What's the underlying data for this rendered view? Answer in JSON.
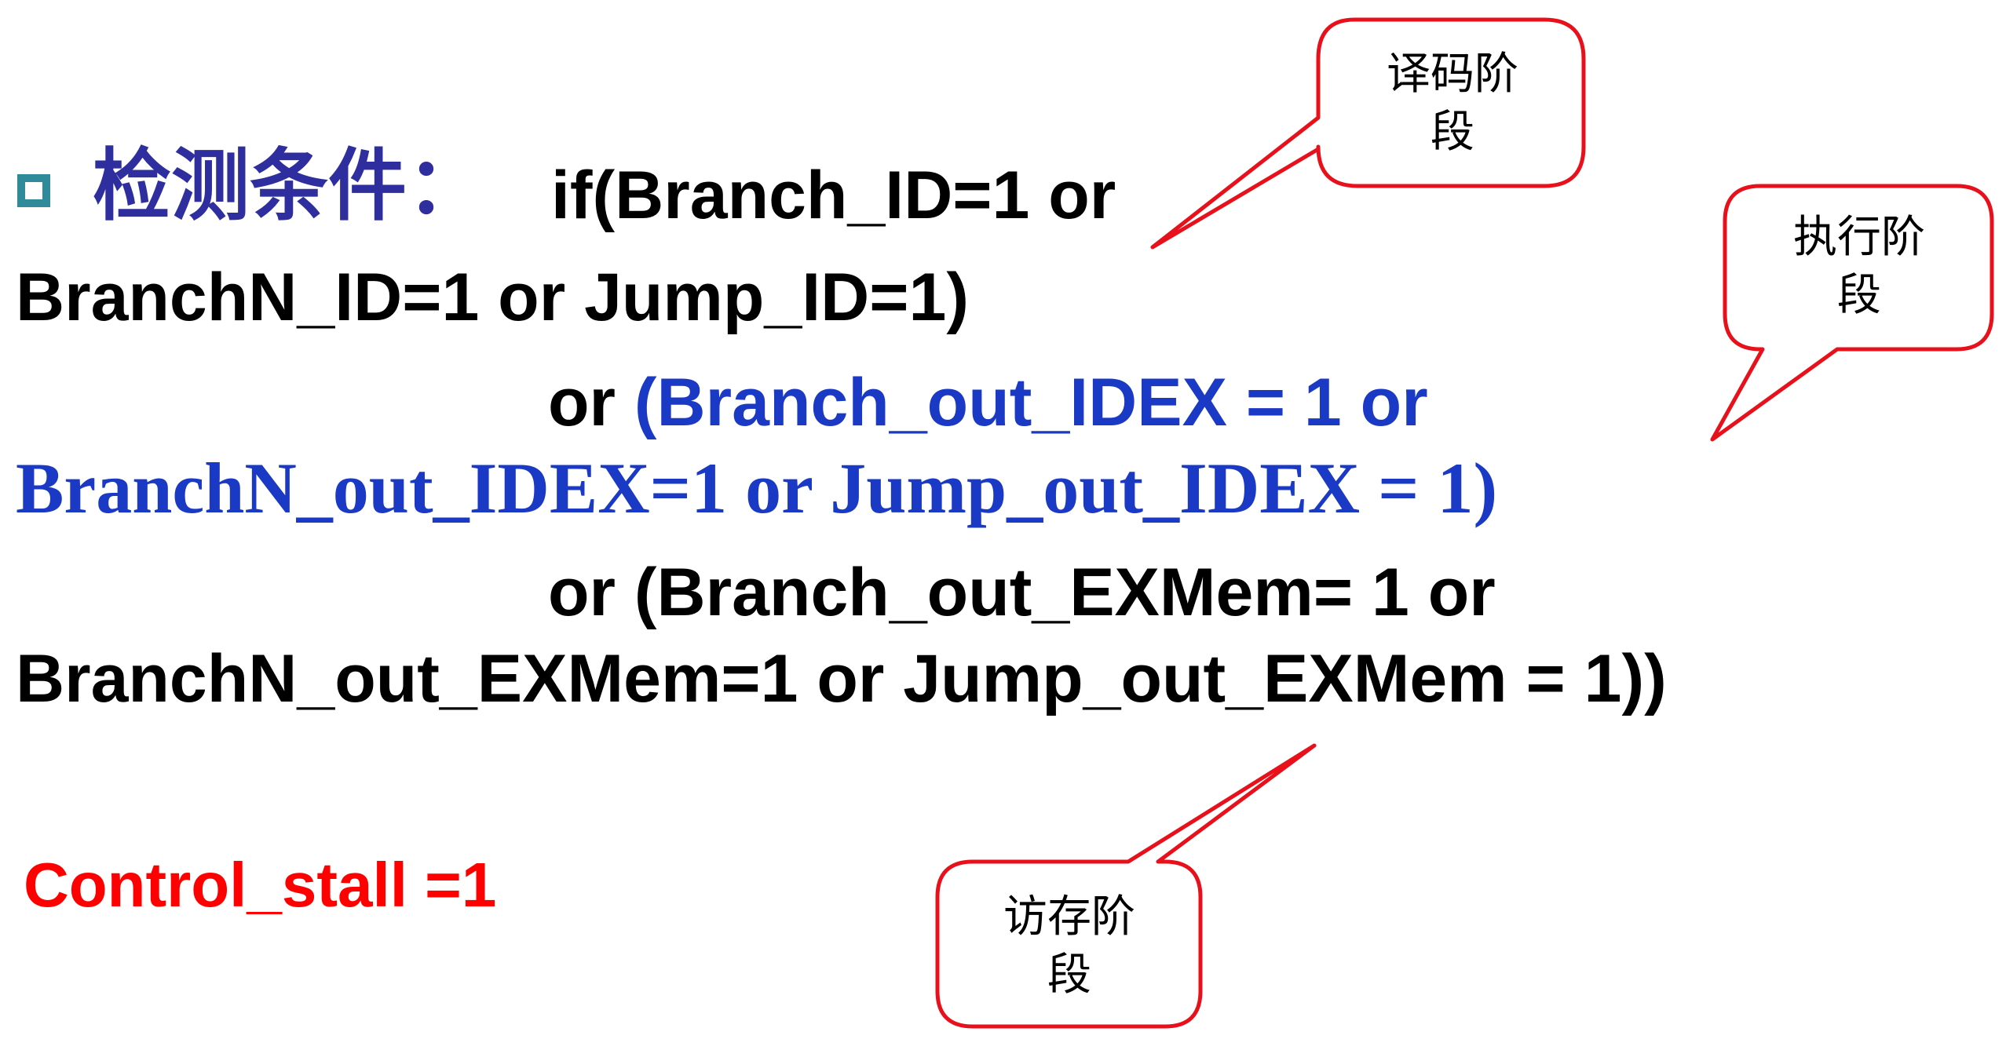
{
  "colors": {
    "heading": "#2e2e9e",
    "code_default": "#000000",
    "code_highlight": "#1a39c4",
    "result": "#ff0000",
    "bullet": "#2f8a99",
    "callout_border": "#e8101a"
  },
  "bullet_icon": "square-bullet-icon",
  "heading": {
    "label": "检测条件："
  },
  "condition": {
    "line1": "if(Branch_ID=1 or",
    "line2": "BranchN_ID=1 or Jump_ID=1)",
    "line3_prefix": "or ",
    "line3_highlight": "(Branch_out_IDEX = 1 or",
    "line4": "BranchN_out_IDEX=1 or Jump_out_IDEX = 1)",
    "line5": "or (Branch_out_EXMem= 1 or",
    "line6": "BranchN_out_EXMem=1 or Jump_out_EXMem = 1))"
  },
  "result": "Control_stall =1",
  "callouts": [
    {
      "line1": "译码阶",
      "line2": "段"
    },
    {
      "line1": "执行阶",
      "line2": "段"
    },
    {
      "line1": "访存阶",
      "line2": "段"
    }
  ]
}
